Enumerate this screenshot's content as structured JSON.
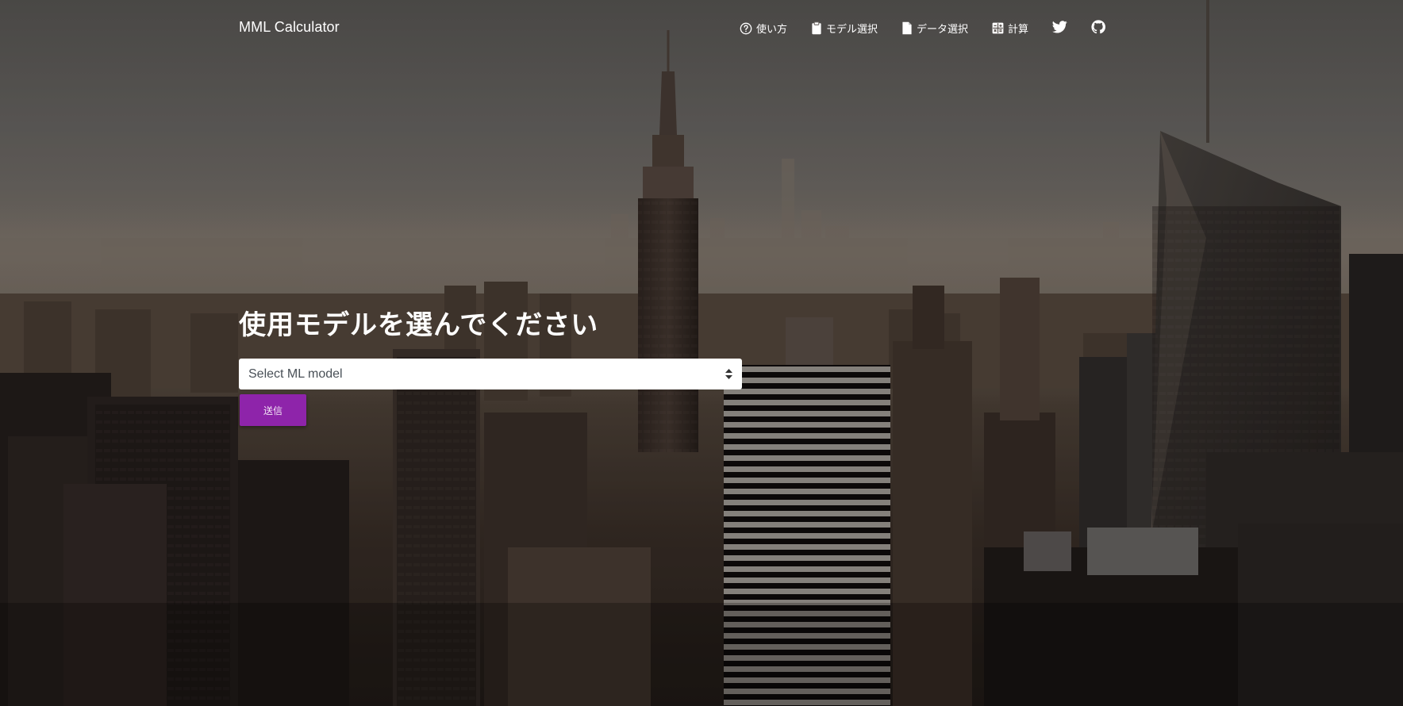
{
  "navbar": {
    "brand": "MML Calculator",
    "items": [
      {
        "label": "使い方",
        "icon": "help-circle-icon"
      },
      {
        "label": "モデル選択",
        "icon": "clipboard-icon"
      },
      {
        "label": "データ選択",
        "icon": "file-icon"
      },
      {
        "label": "計算",
        "icon": "calculator-icon"
      }
    ],
    "social": [
      {
        "icon": "twitter-icon"
      },
      {
        "icon": "github-icon"
      }
    ]
  },
  "main": {
    "heading": "使用モデルを選んでください",
    "select": {
      "value": "Select ML model"
    },
    "submit_label": "送信"
  },
  "colors": {
    "accent": "#8e24aa",
    "text_light": "#ffffff"
  }
}
